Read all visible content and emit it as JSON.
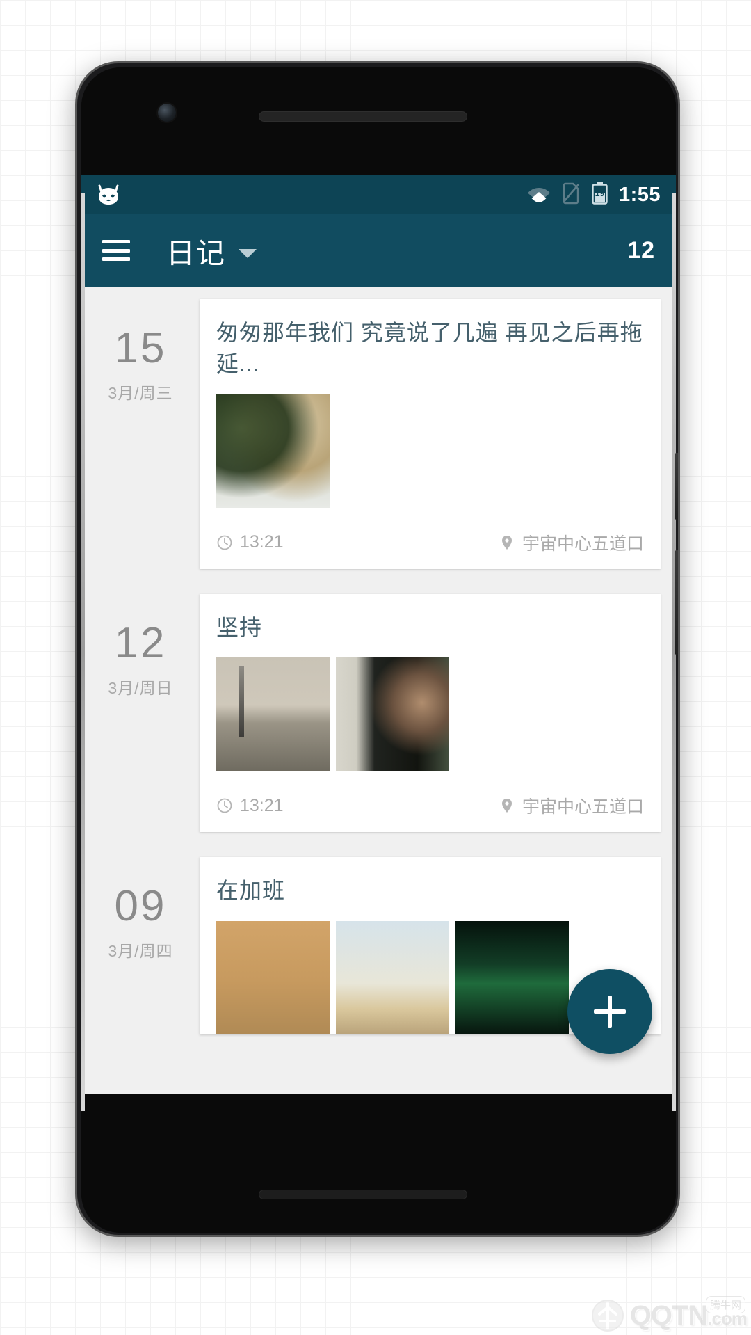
{
  "statusbar": {
    "logo_icon": "cyanogenmod-skull-icon",
    "wifi_icon": "wifi-icon",
    "sim_icon": "no-sim-icon",
    "battery_icon": "battery-icon",
    "battery_level": "19",
    "time": "1:55",
    "bg_color": "#0d4455"
  },
  "appbar": {
    "menu_icon": "hamburger-menu-icon",
    "title": "日记",
    "dropdown_icon": "chevron-down-icon",
    "count": "12",
    "bg_color": "#114c60"
  },
  "entries": [
    {
      "day": "15",
      "subdate": "3月/周三",
      "title": "匆匆那年我们 究竟说了几遍 再见之后再拖延...",
      "time_icon": "clock-icon",
      "time": "13:21",
      "place_icon": "location-pin-icon",
      "place": "宇宙中心五道口",
      "photos": [
        "ph-bride"
      ]
    },
    {
      "day": "12",
      "subdate": "3月/周日",
      "title": "坚持",
      "time_icon": "clock-icon",
      "time": "13:21",
      "place_icon": "location-pin-icon",
      "place": "宇宙中心五道口",
      "photos": [
        "ph-city",
        "ph-man"
      ]
    },
    {
      "day": "09",
      "subdate": "3月/周四",
      "title": "在加班",
      "time_icon": "clock-icon",
      "time": "",
      "place_icon": "location-pin-icon",
      "place": "",
      "photos": [
        "ph-sand",
        "ph-sky",
        "ph-aurora"
      ]
    }
  ],
  "fab": {
    "icon": "plus-icon",
    "label": "+",
    "color": "#0f4f63"
  },
  "navbar": {
    "items": [
      {
        "icon": "overflow-menu-icon"
      },
      {
        "icon": "back-triangle-icon"
      },
      {
        "icon": "home-circle-icon"
      },
      {
        "icon": "recents-square-icon"
      }
    ]
  },
  "watermark": {
    "logo_icon": "qqtn-logo-icon",
    "text": "QQTN",
    "suffix": ".com",
    "badge": "腾牛网"
  }
}
